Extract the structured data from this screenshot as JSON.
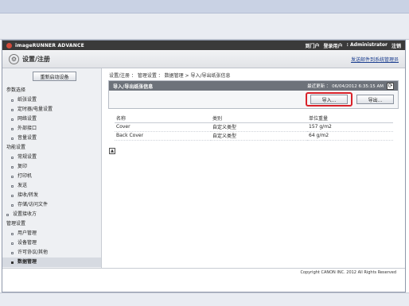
{
  "browser": {
    "address_drop_glyph": "▾"
  },
  "header": {
    "brand": "imageRUNNER ADVANCE",
    "portal_link": "到门户",
    "login_label": "登录用户",
    "user": ": Administrator",
    "logout_link": "注销"
  },
  "titlebar": {
    "icon": "gear-icon",
    "title": "设置/注册",
    "send_link": "发送邮件到系统管理员"
  },
  "sidebar": {
    "restart_button": "重新启动设备",
    "sections": [
      {
        "label": "参数选择",
        "items": [
          "纸张设置",
          "定时器/电量设置",
          "网络设置",
          "外部接口",
          "音量设置"
        ]
      },
      {
        "label": "功能设置",
        "items": [
          "常规设置",
          "复印",
          "打印机",
          "发送",
          "接收/转发",
          "存储/访问文件"
        ]
      },
      {
        "label": "",
        "items": [
          "设置接收方"
        ]
      },
      {
        "label": "管理设置",
        "items": [
          "用户管理",
          "设备管理",
          "许可协议/其他",
          "数据管理"
        ]
      }
    ]
  },
  "main": {
    "breadcrumb": "设置/注册 ： 管理设置 ： 数据管理 > 导入/导出纸张信息",
    "panel_title": "导入/导出纸张信息",
    "last_updated": "最近更新 ： 06/04/2012 6:35:15 AM",
    "import_button": "导入...",
    "export_button": "导出...",
    "table": {
      "columns": [
        "名称",
        "类别",
        "单位重量"
      ],
      "rows": [
        [
          "Cover",
          "自定义类型",
          "157 g/m2"
        ],
        [
          "Back Cover",
          "自定义类型",
          "64 g/m2"
        ]
      ]
    }
  },
  "footer": {
    "copyright": "Copyright CANON INC. 2012 All Rights Reserved"
  },
  "colors": {
    "highlight": "#d9222a",
    "brand_bar": "#3a3a3a",
    "panel_head": "#6d727a"
  }
}
